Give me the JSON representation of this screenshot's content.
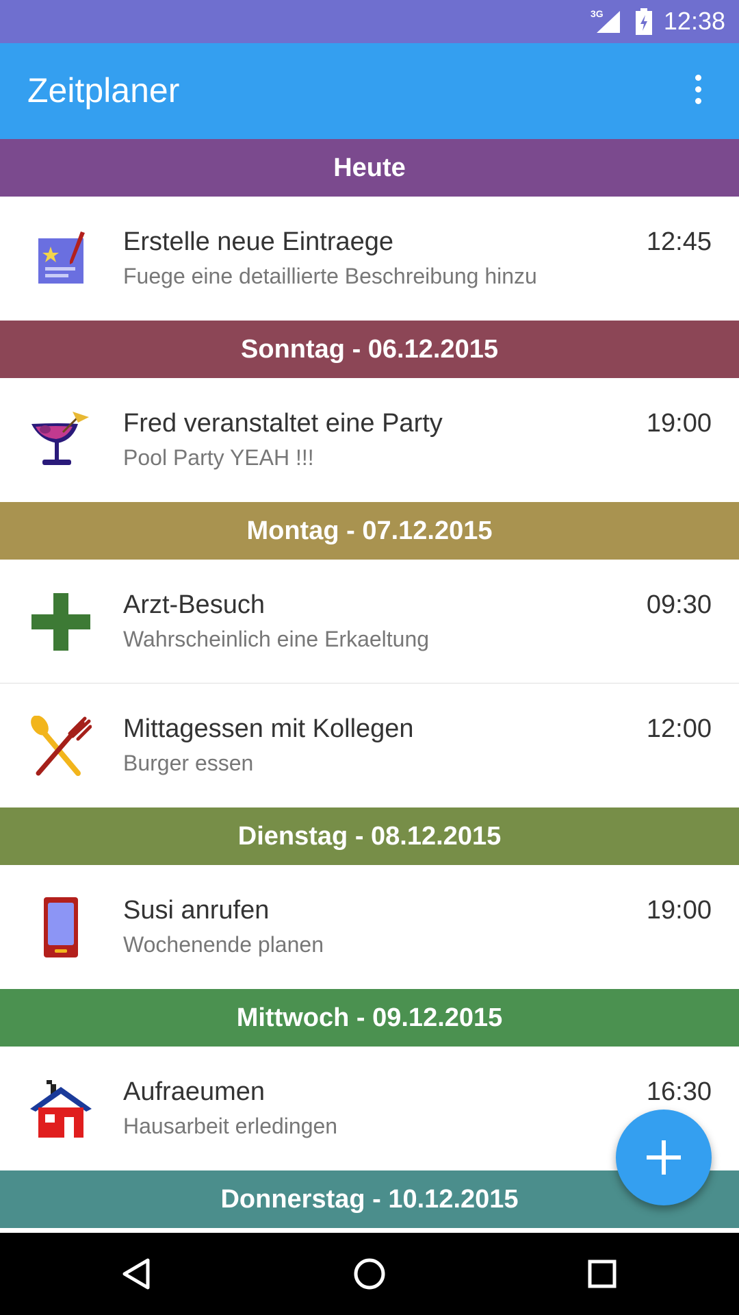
{
  "status_bar": {
    "time": "12:38",
    "network": "3G"
  },
  "app_bar": {
    "title": "Zeitplaner",
    "menu_icon": "more-vertical-icon"
  },
  "sections": [
    {
      "header": "Heute",
      "color": "#7b4a8e",
      "items": [
        {
          "icon": "notepad-icon",
          "title": "Erstelle neue Eintraege",
          "subtitle": "Fuege eine detaillierte Beschreibung hinzu",
          "time": "12:45"
        }
      ]
    },
    {
      "header": "Sonntag - 06.12.2015",
      "color": "#8c4656",
      "items": [
        {
          "icon": "cocktail-icon",
          "title": "Fred veranstaltet eine Party",
          "subtitle": "Pool Party YEAH !!!",
          "time": "19:00"
        }
      ]
    },
    {
      "header": "Montag - 07.12.2015",
      "color": "#a99350",
      "items": [
        {
          "icon": "medical-cross-icon",
          "title": "Arzt-Besuch",
          "subtitle": "Wahrscheinlich eine Erkaeltung",
          "time": "09:30"
        },
        {
          "icon": "cutlery-icon",
          "title": "Mittagessen mit Kollegen",
          "subtitle": "Burger essen",
          "time": "12:00"
        }
      ]
    },
    {
      "header": "Dienstag - 08.12.2015",
      "color": "#778e48",
      "items": [
        {
          "icon": "phone-icon",
          "title": "Susi anrufen",
          "subtitle": "Wochenende planen",
          "time": "19:00"
        }
      ]
    },
    {
      "header": "Mittwoch - 09.12.2015",
      "color": "#4b9150",
      "items": [
        {
          "icon": "house-icon",
          "title": "Aufraeumen",
          "subtitle": "Hausarbeit erledingen",
          "time": "16:30"
        }
      ]
    },
    {
      "header": "Donnerstag - 10.12.2015",
      "color": "#4b8e8c",
      "items": []
    }
  ],
  "fab": {
    "icon": "plus-icon"
  },
  "nav_bar": {
    "back": "back-icon",
    "home": "home-icon",
    "recents": "recents-icon"
  }
}
